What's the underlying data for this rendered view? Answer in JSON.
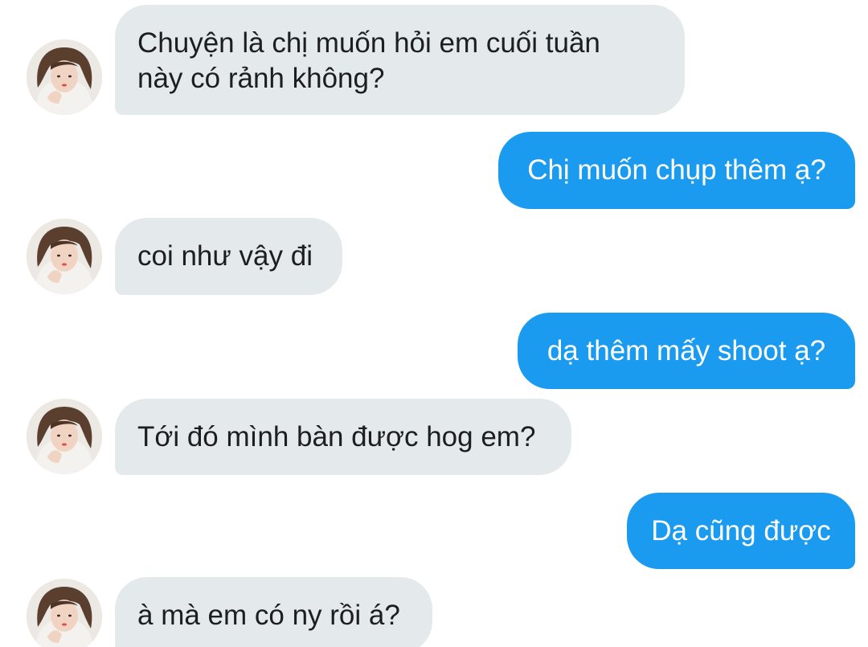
{
  "conversation": {
    "messages": [
      {
        "direction": "incoming",
        "text": "Chuyện là chị muốn hỏi em cuối tuần\nnày có rảnh không?"
      },
      {
        "direction": "outgoing",
        "text": "Chị muốn chụp thêm ạ?"
      },
      {
        "direction": "incoming",
        "text": "coi như vậy đi"
      },
      {
        "direction": "outgoing",
        "text": "dạ thêm mấy shoot ạ?"
      },
      {
        "direction": "incoming",
        "text": "Tới đó mình bàn được hog em?"
      },
      {
        "direction": "outgoing",
        "text": "Dạ cũng được"
      },
      {
        "direction": "incoming",
        "text": "à mà em có ny rồi á?"
      }
    ]
  },
  "colors": {
    "incoming_bubble": "#e4e9ec",
    "outgoing_bubble": "#1b9bf0",
    "incoming_text": "#1c1e21",
    "outgoing_text": "#ffffff"
  },
  "icons": {
    "avatar": "contact-avatar-photo"
  }
}
